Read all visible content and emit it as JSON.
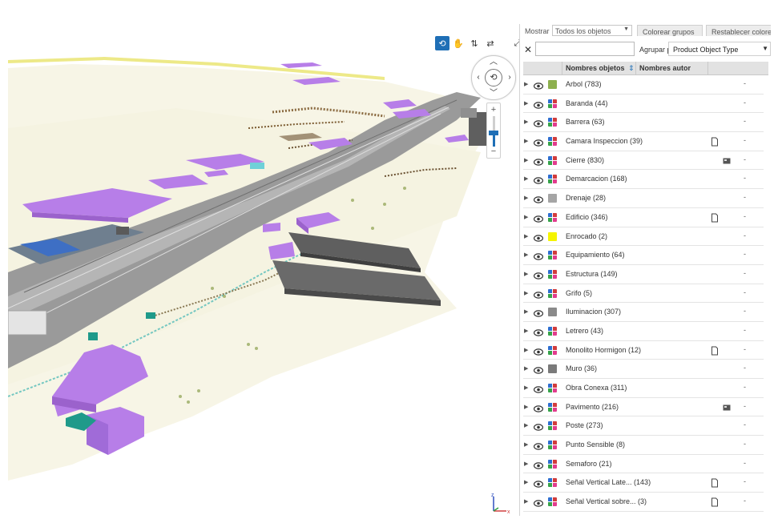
{
  "toolbar": {
    "mostrar_label": "Mostrar",
    "mostrar_value": "Todos los objetos",
    "colorear_button": "Colorear grupos",
    "restablecer_button": "Restablecer colores",
    "agrupar_label": "Agrupar por:",
    "agrupar_value": "Product Object Type"
  },
  "table": {
    "col_name": "Nombres objetos",
    "col_author": "Nombres autor",
    "rows": [
      {
        "label": "Arbol (783)",
        "color": "#8db04e",
        "multi": false,
        "extra": "",
        "value": "-"
      },
      {
        "label": "Baranda (44)",
        "color": "",
        "multi": true,
        "extra": "",
        "value": "-"
      },
      {
        "label": "Barrera (63)",
        "color": "",
        "multi": true,
        "extra": "",
        "value": "-"
      },
      {
        "label": "Camara Inspeccion (39)",
        "color": "",
        "multi": true,
        "extra": "file-icon",
        "value": "-"
      },
      {
        "label": "Cierre (830)",
        "color": "",
        "multi": true,
        "extra": "photo-icon",
        "value": "-"
      },
      {
        "label": "Demarcacion (168)",
        "color": "",
        "multi": true,
        "extra": "",
        "value": "-"
      },
      {
        "label": "Drenaje (28)",
        "color": "#a5a5a5",
        "multi": false,
        "extra": "",
        "value": "-"
      },
      {
        "label": "Edificio (346)",
        "color": "",
        "multi": true,
        "extra": "file-icon",
        "value": "-"
      },
      {
        "label": "Enrocado (2)",
        "color": "#f5f400",
        "multi": false,
        "extra": "",
        "value": "-"
      },
      {
        "label": "Equipamiento (64)",
        "color": "",
        "multi": true,
        "extra": "",
        "value": "-"
      },
      {
        "label": "Estructura (149)",
        "color": "",
        "multi": true,
        "extra": "",
        "value": "-"
      },
      {
        "label": "Grifo (5)",
        "color": "",
        "multi": true,
        "extra": "",
        "value": "-"
      },
      {
        "label": "Iluminacion (307)",
        "color": "#8a8a8a",
        "multi": false,
        "extra": "",
        "value": "-"
      },
      {
        "label": "Letrero (43)",
        "color": "",
        "multi": true,
        "extra": "",
        "value": "-"
      },
      {
        "label": "Monolito Hormigon (12)",
        "color": "",
        "multi": true,
        "extra": "file-icon",
        "value": "-"
      },
      {
        "label": "Muro (36)",
        "color": "#7a7a7a",
        "multi": false,
        "extra": "",
        "value": "-"
      },
      {
        "label": "Obra Conexa (311)",
        "color": "",
        "multi": true,
        "extra": "",
        "value": "-"
      },
      {
        "label": "Pavimento (216)",
        "color": "",
        "multi": true,
        "extra": "photo-icon",
        "value": "-"
      },
      {
        "label": "Poste (273)",
        "color": "",
        "multi": true,
        "extra": "",
        "value": "-"
      },
      {
        "label": "Punto Sensible (8)",
        "color": "",
        "multi": true,
        "extra": "",
        "value": "-"
      },
      {
        "label": "Semaforo (21)",
        "color": "",
        "multi": true,
        "extra": "",
        "value": "-"
      },
      {
        "label": "Señal Vertical Late... (143)",
        "color": "",
        "multi": true,
        "extra": "file-icon",
        "value": "-"
      },
      {
        "label": "Señal Vertical sobre... (3)",
        "color": "",
        "multi": true,
        "extra": "file-icon",
        "value": "-"
      }
    ]
  },
  "viewport": {
    "axis_labels": {
      "z": "z",
      "x": "x"
    },
    "zoom_level": 0.45
  },
  "colors": {
    "accent": "#1f6fb6",
    "building": "#b77ee8",
    "ground": "#f7f5e6",
    "road": "#8f8f8f",
    "dark_block": "#5f5f5f"
  }
}
